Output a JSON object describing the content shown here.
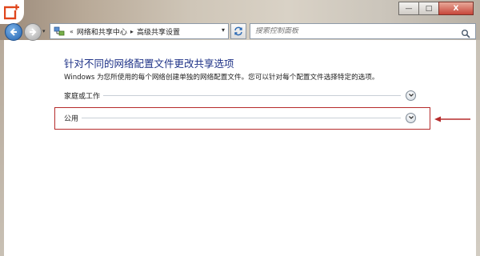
{
  "window": {
    "controls": {
      "minimize": "—",
      "maximize": "□",
      "close": "X"
    }
  },
  "icons": {
    "logo": "app-logo-icon",
    "back": "back-arrow-icon",
    "forward": "forward-arrow-icon",
    "network": "network-sharing-icon",
    "refresh": "refresh-icon",
    "search": "search-icon",
    "expand": "chevron-down-icon"
  },
  "address_bar": {
    "prefix": "«",
    "breadcrumbs": [
      "网络和共享中心",
      "高级共享设置"
    ],
    "separator": "▸"
  },
  "search": {
    "placeholder": "搜索控制面板"
  },
  "page": {
    "title": "针对不同的网络配置文件更改共享选项",
    "description": "Windows 为您所使用的每个网络创建单独的网络配置文件。您可以针对每个配置文件选择特定的选项。"
  },
  "sections": [
    {
      "label": "家庭或工作"
    },
    {
      "label": "公用"
    }
  ],
  "colors": {
    "title": "#1e3287",
    "highlight": "#b52b2b",
    "accent": "#2363b0"
  }
}
